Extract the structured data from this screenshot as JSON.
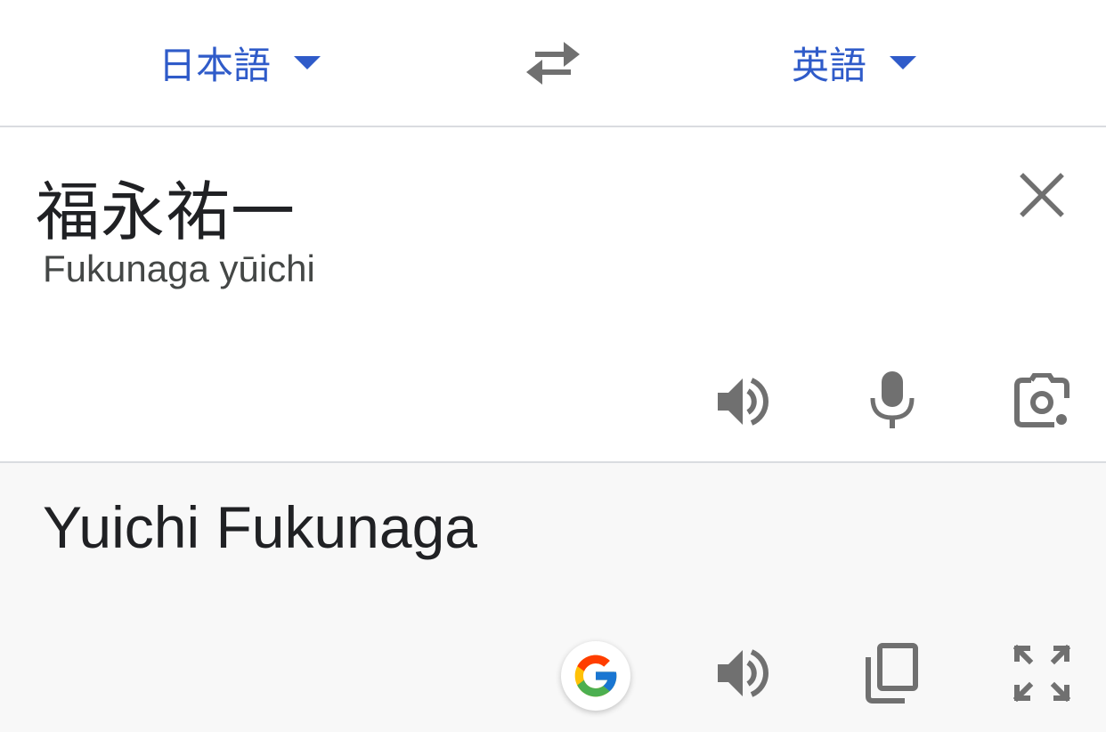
{
  "header": {
    "source_language": "日本語",
    "target_language": "英語"
  },
  "input": {
    "text": "福永祐一",
    "transliteration": "Fukunaga yūichi"
  },
  "output": {
    "text": "Yuichi Fukunaga"
  },
  "icons": {
    "header": [
      "chevron-down-icon",
      "swap-icon",
      "chevron-down-icon"
    ],
    "input": [
      "close-icon",
      "speaker-icon",
      "microphone-icon",
      "camera-icon"
    ],
    "output": [
      "google-icon",
      "speaker-icon",
      "copy-icon",
      "fullscreen-icon"
    ]
  },
  "colors": {
    "accent": "#2f5bc9",
    "icon": "#707070",
    "output_background": "#f8f8f8",
    "divider": "#dadce0",
    "google_blue": "#4285F4",
    "google_red": "#EA4335",
    "google_yellow": "#FBBC05",
    "google_green": "#34A853"
  }
}
